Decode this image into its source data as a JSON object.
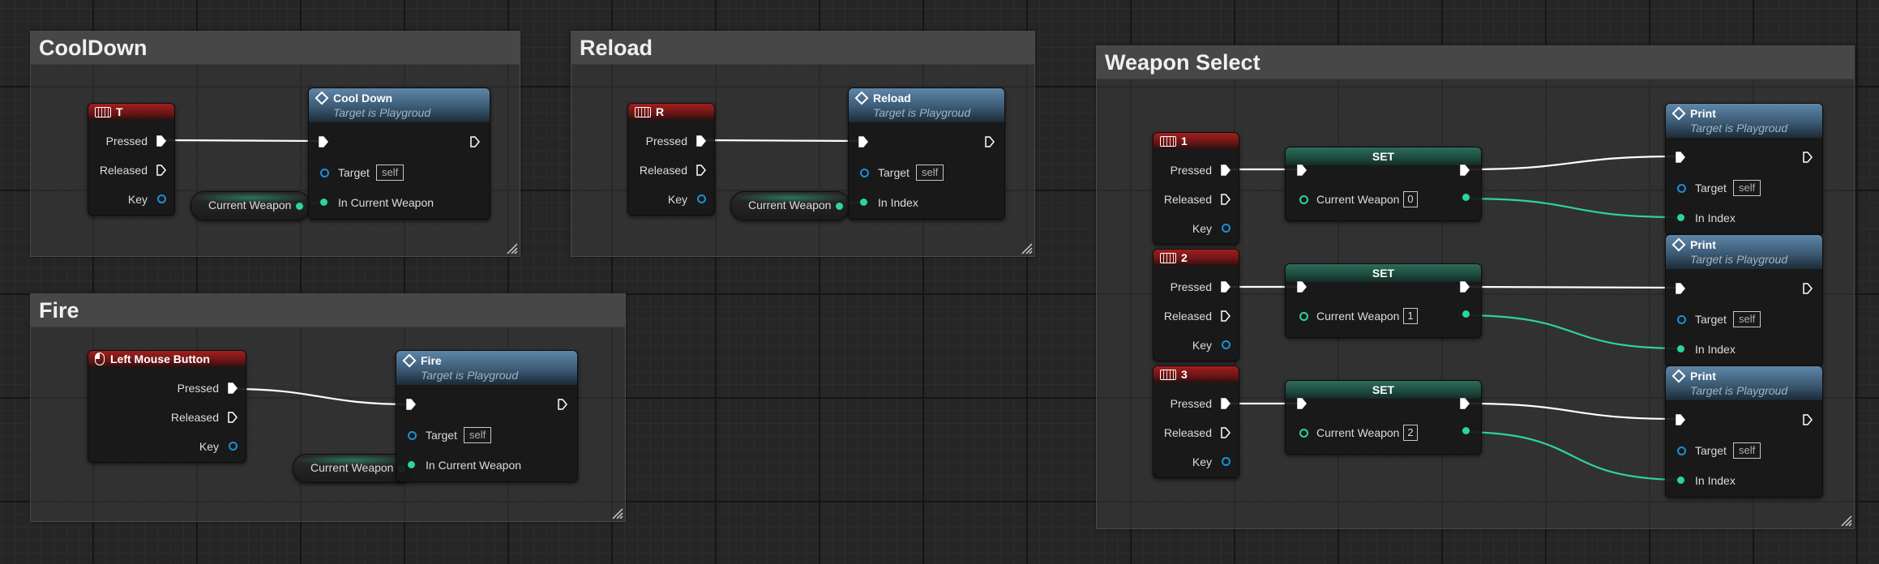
{
  "comments": {
    "cooldown": "CoolDown",
    "reload": "Reload",
    "fire": "Fire",
    "weapon_select": "Weapon Select"
  },
  "labels": {
    "pressed": "Pressed",
    "released": "Released",
    "key": "Key",
    "target": "Target",
    "self": "self",
    "in_current_weapon": "In Current Weapon",
    "in_index": "In Index",
    "current_weapon": "Current Weapon",
    "target_is": "Target is Playgroud",
    "set": "SET"
  },
  "events": {
    "t": "T",
    "r": "R",
    "lmb": "Left Mouse Button",
    "k1": "1",
    "k2": "2",
    "k3": "3"
  },
  "functions": {
    "cooldown": "Cool Down",
    "reload": "Reload",
    "fire": "Fire",
    "print": "Print"
  },
  "set_values": [
    "0",
    "1",
    "2"
  ],
  "colors": {
    "exec_wire": "#ffffff",
    "int_wire": "#2ed3a0",
    "object_pin": "#1a8fd8",
    "event_header": "#a31e1e",
    "function_header": "#5f86a8",
    "set_header": "#2d6b5a"
  }
}
